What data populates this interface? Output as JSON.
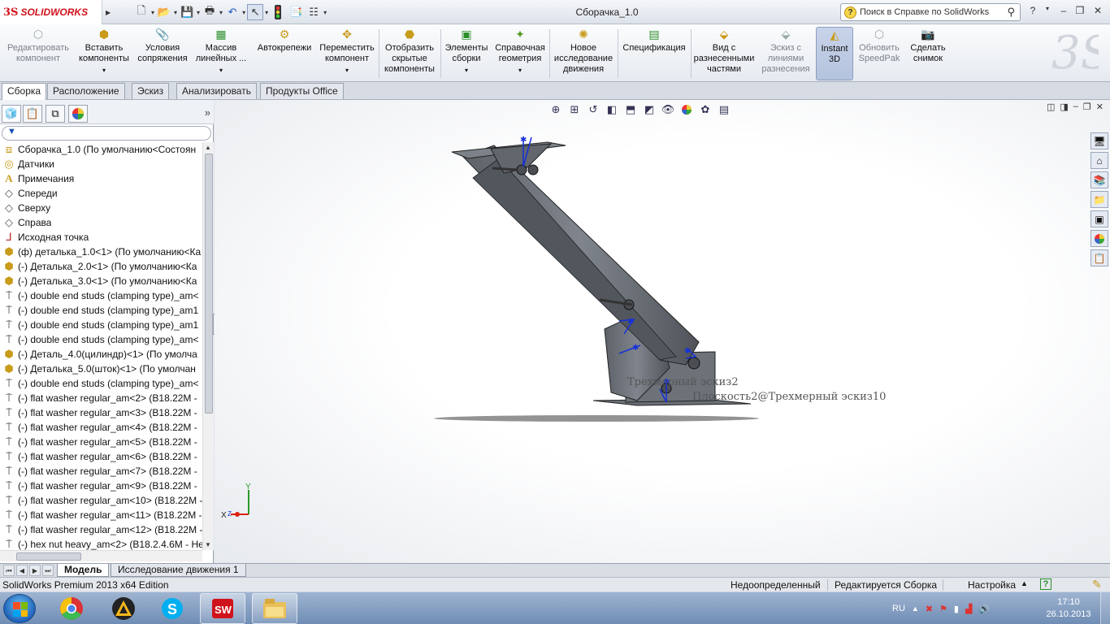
{
  "titlebar": {
    "brand": "SOLIDWORKS",
    "brand_mark": "3S",
    "document_title": "Сборачка_1.0",
    "help_search_placeholder": "Поиск в Справке по SolidWorks",
    "help_label": "?"
  },
  "ribbon": {
    "commands": [
      {
        "label_1": "Редактировать",
        "label_2": "компонент",
        "label_3": "",
        "icon": "edit-component-icon",
        "disabled": true
      },
      {
        "label_1": "Вставить",
        "label_2": "компоненты",
        "label_3": "",
        "icon": "insert-components-icon",
        "dropdown": true
      },
      {
        "label_1": "Условия",
        "label_2": "сопряжения",
        "label_3": "",
        "icon": "mate-icon"
      },
      {
        "label_1": "Массив",
        "label_2": "линейных ...",
        "label_3": "",
        "icon": "linear-pattern-icon",
        "dropdown": true
      },
      {
        "label_1": "Автокрепежи",
        "label_2": "",
        "label_3": "",
        "icon": "smart-fasteners-icon"
      },
      {
        "label_1": "Переместить",
        "label_2": "компонент",
        "label_3": "",
        "icon": "move-component-icon",
        "dropdown": true
      },
      {
        "label_1": "Отобразить",
        "label_2": "скрытые",
        "label_3": "компоненты",
        "icon": "show-hidden-icon"
      },
      {
        "label_1": "Элементы",
        "label_2": "сборки",
        "label_3": "",
        "icon": "assembly-features-icon",
        "dropdown": true
      },
      {
        "label_1": "Справочная",
        "label_2": "геометрия",
        "label_3": "",
        "icon": "reference-geometry-icon",
        "dropdown": true
      },
      {
        "label_1": "Новое",
        "label_2": "исследование",
        "label_3": "движения",
        "icon": "motion-study-icon"
      },
      {
        "label_1": "Спецификация",
        "label_2": "",
        "label_3": "",
        "icon": "bom-icon"
      },
      {
        "label_1": "Вид с",
        "label_2": "разнесенными",
        "label_3": "частями",
        "icon": "exploded-view-icon"
      },
      {
        "label_1": "Эскиз с",
        "label_2": "линиями",
        "label_3": "разнесения",
        "icon": "explode-line-sketch-icon",
        "disabled": true
      },
      {
        "label_1": "Instant",
        "label_2": "3D",
        "label_3": "",
        "icon": "instant3d-icon",
        "active": true
      },
      {
        "label_1": "Обновить",
        "label_2": "SpeedPak",
        "label_3": "",
        "icon": "speedpak-icon",
        "disabled": true
      },
      {
        "label_1": "Сделать",
        "label_2": "снимок",
        "label_3": "",
        "icon": "snapshot-icon"
      }
    ]
  },
  "tabs": [
    "Сборка",
    "Расположение",
    "Эскиз",
    "Анализировать",
    "Продукты Office"
  ],
  "tree": {
    "filter_symbol": "▼",
    "nodes": [
      {
        "label": "Сборачка_1.0  (По умолчанию<Состоян",
        "icon": "assembly-icon"
      },
      {
        "label": "Датчики",
        "icon": "sensor-icon"
      },
      {
        "label": "Примечания",
        "icon": "annotation-icon"
      },
      {
        "label": "Спереди",
        "icon": "plane-icon"
      },
      {
        "label": "Сверху",
        "icon": "plane-icon"
      },
      {
        "label": "Справа",
        "icon": "plane-icon"
      },
      {
        "label": "Исходная точка",
        "icon": "origin-icon"
      },
      {
        "label": "(ф) деталька_1.0<1> (По умолчанию<Ка",
        "icon": "part-icon"
      },
      {
        "label": "(-) Деталька_2.0<1> (По умолчанию<Ка",
        "icon": "part-icon"
      },
      {
        "label": "(-) Деталька_3.0<1> (По умолчанию<Ка",
        "icon": "part-icon"
      },
      {
        "label": "(-) double end studs (clamping type)_am<",
        "icon": "fastener-icon"
      },
      {
        "label": "(-) double end studs (clamping type)_am1",
        "icon": "fastener-icon"
      },
      {
        "label": "(-) double end studs (clamping type)_am1",
        "icon": "fastener-icon"
      },
      {
        "label": "(-) double end studs (clamping type)_am<",
        "icon": "fastener-icon"
      },
      {
        "label": "(-) Деталь_4.0(цилиндр)<1> (По умолча",
        "icon": "part-icon"
      },
      {
        "label": "(-) Деталька_5.0(шток)<1> (По умолчан",
        "icon": "part-icon"
      },
      {
        "label": "(-) double end studs (clamping type)_am<",
        "icon": "fastener-icon"
      },
      {
        "label": "(-) flat washer regular_am<2> (B18.22M -",
        "icon": "fastener-icon"
      },
      {
        "label": "(-) flat washer regular_am<3> (B18.22M -",
        "icon": "fastener-icon"
      },
      {
        "label": "(-) flat washer regular_am<4> (B18.22M -",
        "icon": "fastener-icon"
      },
      {
        "label": "(-) flat washer regular_am<5> (B18.22M -",
        "icon": "fastener-icon"
      },
      {
        "label": "(-) flat washer regular_am<6> (B18.22M -",
        "icon": "fastener-icon"
      },
      {
        "label": "(-) flat washer regular_am<7> (B18.22M -",
        "icon": "fastener-icon"
      },
      {
        "label": "(-) flat washer regular_am<9> (B18.22M -",
        "icon": "fastener-icon"
      },
      {
        "label": "(-) flat washer regular_am<10> (B18.22M -",
        "icon": "fastener-icon"
      },
      {
        "label": "(-) flat washer regular_am<11> (B18.22M -",
        "icon": "fastener-icon"
      },
      {
        "label": "(-) flat washer regular_am<12> (B18.22M -",
        "icon": "fastener-icon"
      },
      {
        "label": "(-) hex nut heavy_am<2> (B18.2.4.6M - He",
        "icon": "fastener-icon"
      }
    ]
  },
  "viewport": {
    "sketch_labels": [
      "Трехмерный эскиз2",
      "Плоскость2@Трехмерный эскиз10"
    ],
    "triad": {
      "x": "X",
      "y": "Y",
      "z": "Z"
    }
  },
  "model_tabs": [
    "Модель",
    "Исследование движения 1"
  ],
  "statusbar": {
    "edition": "SolidWorks Premium 2013 x64 Edition",
    "definition": "Недоопределенный",
    "editing": "Редактируется Сборка",
    "settings": "Настройка",
    "help": "?"
  },
  "taskbar": {
    "apps": [
      "chrome-icon",
      "archicad-icon",
      "skype-icon",
      "solidworks-icon",
      "explorer-icon"
    ],
    "lang": "RU",
    "time": "17:10",
    "date": "26.10.2013"
  },
  "colors": {
    "brand_red": "#d0121b",
    "model_gray": "#6b7078",
    "sketch_blue": "#1530d8",
    "ribbon_active": "#b4c3de"
  }
}
